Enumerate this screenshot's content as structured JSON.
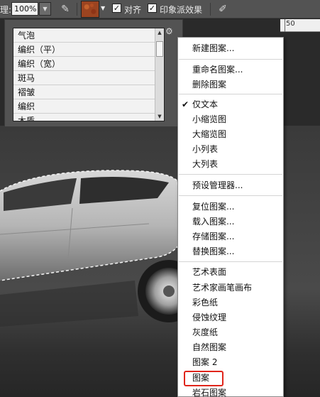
{
  "options_bar": {
    "mode_label": "理:",
    "opacity_value": "100%",
    "aligned_label": "对齐",
    "impressionist_label": "印象派效果",
    "aligned_checked": true,
    "impressionist_checked": true,
    "pattern_swatch_color": "#9c4420"
  },
  "ruler": {
    "label": "50"
  },
  "pattern_list": {
    "items": [
      "气泡",
      "编织（平）",
      "编织（宽）",
      "斑马",
      "褶皱",
      "编织",
      "木质"
    ]
  },
  "menu": {
    "items": [
      "新建图案...",
      "重命名图案...",
      "删除图案",
      "仅文本",
      "小缩览图",
      "大缩览图",
      "小列表",
      "大列表",
      "预设管理器...",
      "复位图案...",
      "载入图案...",
      "存储图案...",
      "替换图案...",
      "艺术表面",
      "艺术家画笔画布",
      "彩色纸",
      "侵蚀纹理",
      "灰度纸",
      "自然图案",
      "图案 2",
      "图案",
      "岩石图案"
    ],
    "checked_item": "仅文本",
    "highlight_color": "#e0251b"
  }
}
